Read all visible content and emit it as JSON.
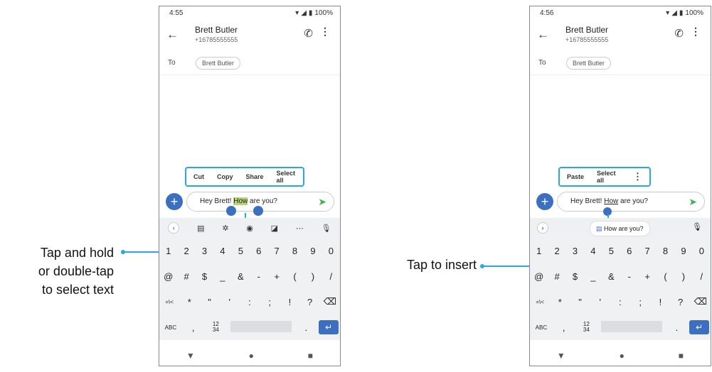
{
  "left_screen": {
    "time": "4:55",
    "battery": "100%",
    "contact_name": "Brett Butler",
    "contact_number": "+16785555555",
    "to_label": "To",
    "recipient_chip": "Brett Butler",
    "toolbar": [
      "Cut",
      "Copy",
      "Share",
      "Select all"
    ],
    "message_before": "Hey Brett! ",
    "message_selected": "How",
    "message_after": " are you?",
    "num_row": [
      "1",
      "2",
      "3",
      "4",
      "5",
      "6",
      "7",
      "8",
      "9",
      "0"
    ],
    "sym_row": [
      "@",
      "#",
      "$",
      "_",
      "&",
      "-",
      "+",
      "(",
      ")",
      "/"
    ],
    "sym_row2": [
      "=\\<",
      "*",
      "\"",
      "'",
      ":",
      ";",
      "!",
      "?",
      "⌫"
    ],
    "abc_key": "ABC",
    "comma_key": ",",
    "fraction_key": "12\n34",
    "period_key": "."
  },
  "right_screen": {
    "time": "4:56",
    "battery": "100%",
    "contact_name": "Brett Butler",
    "contact_number": "+16785555555",
    "to_label": "To",
    "recipient_chip": "Brett Butler",
    "toolbar": [
      "Paste",
      "Select all"
    ],
    "message_before": "Hey Brett! ",
    "message_word": "How",
    "message_after": " are you?",
    "clipboard_suggestion": "How are you?",
    "num_row": [
      "1",
      "2",
      "3",
      "4",
      "5",
      "6",
      "7",
      "8",
      "9",
      "0"
    ],
    "sym_row": [
      "@",
      "#",
      "$",
      "_",
      "&",
      "-",
      "+",
      "(",
      ")",
      "/"
    ],
    "sym_row2": [
      "=\\<",
      "*",
      "\"",
      "'",
      ":",
      ";",
      "!",
      "?",
      "⌫"
    ],
    "abc_key": "ABC",
    "comma_key": ",",
    "fraction_key": "12\n34",
    "period_key": "."
  },
  "callouts": {
    "left_line1": "Tap and hold",
    "left_line2": "or double-tap",
    "left_line3": "to select text",
    "right": "Tap to insert"
  },
  "colors": {
    "accent": "#2aa7e0",
    "fab": "#3d6fc1",
    "send": "#3cb44b",
    "highlight": "#b8d47a"
  }
}
